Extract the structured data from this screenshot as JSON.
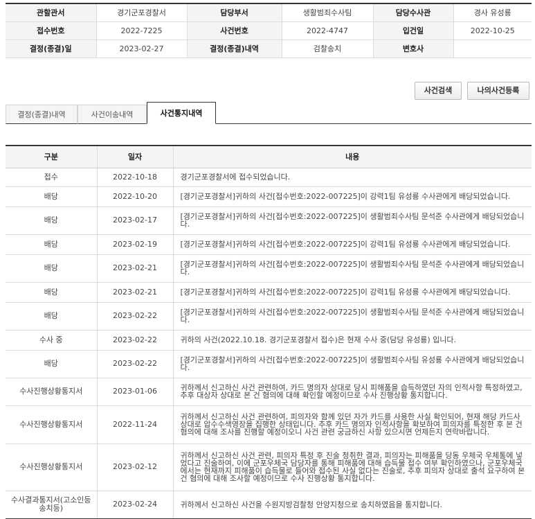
{
  "info": {
    "rows": [
      [
        "관할관서",
        "경기군포경찰서",
        "담당부서",
        "생활범죄수사팀",
        "담당수사관",
        "경사 유성룡"
      ],
      [
        "접수번호",
        "2022-7225",
        "사건번호",
        "2022-4747",
        "입건일",
        "2022-10-25"
      ],
      [
        "결정(종결)일",
        "2023-02-27",
        "결정(종결)내역",
        "검찰송치",
        "변호사",
        ""
      ]
    ]
  },
  "buttons": {
    "search": "사건검색",
    "register": "나의사건등록"
  },
  "tabs": [
    "결정(종결)내역",
    "사건이송내역",
    "사건통지내역"
  ],
  "active_tab": 2,
  "table": {
    "headers": [
      "구분",
      "일자",
      "내용"
    ],
    "rows": [
      [
        "접수",
        "2022-10-18",
        "경기군포경찰서에 접수되었습니다."
      ],
      [
        "배당",
        "2022-10-20",
        "[경기군포경찰서]귀하의 사건[접수번호:2022-007225]이 강력1팀 유성룡 수사관에게 배당되었습니다."
      ],
      [
        "배당",
        "2023-02-17",
        "[경기군포경찰서]귀하의 사건[접수번호:2022-007225]이 생활범죄수사팀 문석준 수사관에게 배당되었습니다."
      ],
      [
        "배당",
        "2023-02-19",
        "[경기군포경찰서]귀하의 사건[접수번호:2022-007225]이 강력1팀 유성룡 수사관에게 배당되었습니다."
      ],
      [
        "배당",
        "2023-02-21",
        "[경기군포경찰서]귀하의 사건[접수번호:2022-007225]이 생활범죄수사팀 문석준 수사관에게 배당되었습니다."
      ],
      [
        "배당",
        "2023-02-21",
        "[경기군포경찰서]귀하의 사건[접수번호:2022-007225]이 강력1팀 유성룡 수사관에게 배당되었습니다."
      ],
      [
        "배당",
        "2023-02-22",
        "[경기군포경찰서]귀하의 사건[접수번호:2022-007225]이 생활범죄수사팀 문석준 수사관에게 배당되었습니다."
      ],
      [
        "수사 중",
        "2023-02-22",
        "귀하의 사건(2022.10.18. 경기군포경찰서 접수)은 현재 수사 중(담당 유성룡) 입니다."
      ],
      [
        "배당",
        "2023-02-22",
        "[경기군포경찰서]귀하의 사건[접수번호:2022-007225]이 생활범죄수사팀 유성룡 수사관에게 배당되었습니다."
      ],
      [
        "수사진행상황통지서",
        "2023-01-06",
        "귀하께서 신고하신 사건 관련하여, 카드 명의자 상대로 당시 피해품을 습득하였던 자의 인적사항 특정하였고, 추후 대상자 상대로 본 건 혐의에 대해 확인할 예정이므로 수사 진행상황 통지합니다."
      ],
      [
        "수사진행상황통지서",
        "2022-11-24",
        "귀하께서 신고하신 사건 관련하여, 피의자와 함께 있던 자가 카드를 사용한 사실 확인되어, 현재 해당 카드사 상대로 압수수색영장을 집행한 상태입니다. 추후 카드 명의자 인적사항을 확보하여 피의자를 특정한 후 본 건 혐의에 대해 조사를 진행할 예정이오니 사건 관련 궁금하신 사항 있으시면 언제든지 연락바랍니다."
      ],
      [
        "수사진행상황통지서",
        "2023-02-12",
        "귀하께서 신고하신 사건 관련, 피의자 특정 후 진술 청취한 결과, 피의자는 피해품을 당동 우체국 우체통에 넣었다고 진술하여, 이에 군포우체국 담당자를 통해 피해품에 대해 습득물 접수 여부 확인하였으나, 군포우체국에서는 현재까지 피해품이 습득물로 들어와 접수된 사실 없다는 진술로, 추후 피의자 상대로 출석 요구하여 본 건 혐의에 대해 조사할 예정이므로 수사 진행상황 통지합니다."
      ],
      [
        "수사결과통지서(고소인등송치등)",
        "2023-02-24",
        "귀하께서 신고하신 사건을 수원지방검찰청 안양지청으로 송치하였음을 통지합니다."
      ]
    ]
  }
}
